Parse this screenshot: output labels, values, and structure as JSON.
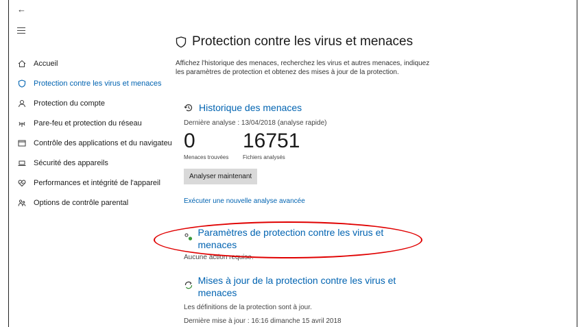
{
  "nav": {
    "back_icon": "back-arrow-icon",
    "menu_icon": "hamburger-icon",
    "items": [
      {
        "label": "Accueil",
        "icon": "home-icon"
      },
      {
        "label": "Protection contre les virus et menaces",
        "icon": "shield-icon",
        "active": true
      },
      {
        "label": "Protection du compte",
        "icon": "person-icon"
      },
      {
        "label": "Pare-feu et protection du réseau",
        "icon": "wifi-icon"
      },
      {
        "label": "Contrôle des applications et du navigateu",
        "icon": "browser-icon"
      },
      {
        "label": "Sécurité des appareils",
        "icon": "laptop-icon"
      },
      {
        "label": "Performances et intégrité de l'appareil",
        "icon": "heart-icon"
      },
      {
        "label": "Options de contrôle parental",
        "icon": "family-icon"
      }
    ]
  },
  "main": {
    "title": "Protection contre les virus et menaces",
    "description": "Affichez l'historique des menaces, recherchez les virus et autres menaces, indiquez les paramètres de protection et obtenez des mises à jour de la protection.",
    "history": {
      "heading": "Historique des menaces",
      "last_scan": "Dernière analyse : 13/04/2018 (analyse rapide)",
      "threats_count": "0",
      "threats_label": "Menaces trouvées",
      "files_count": "16751",
      "files_label": "Fichiers analysés",
      "scan_button": "Analyser maintenant",
      "advanced_link": "Exécuter une nouvelle analyse avancée"
    },
    "settings": {
      "heading": "Paramètres de protection contre les virus et menaces",
      "status": "Aucune action requise."
    },
    "updates": {
      "heading": "Mises à jour de la protection contre les virus et menaces",
      "status": "Les définitions de la protection sont à jour.",
      "last_update": "Dernière mise à jour : 16:16 dimanche 15 avril 2018"
    }
  },
  "colors": {
    "accent": "#0063b1",
    "highlight": "#e00000"
  }
}
